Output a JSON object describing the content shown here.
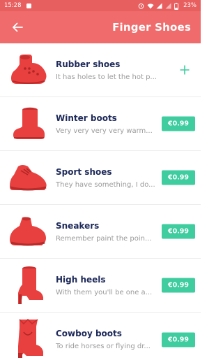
{
  "status_bar": {
    "time": "15:28",
    "battery": "23%"
  },
  "app_bar": {
    "title": "Finger Shoes"
  },
  "items": [
    {
      "name": "Rubber shoes",
      "desc": "It has holes to let the hot p...",
      "action": "add"
    },
    {
      "name": "Winter boots",
      "desc": "Very very very very warm...",
      "action": "price",
      "price": "€0.99"
    },
    {
      "name": "Sport shoes",
      "desc": "They have something, I do...",
      "action": "price",
      "price": "€0.99"
    },
    {
      "name": "Sneakers",
      "desc": "Remember paint the poin...",
      "action": "price",
      "price": "€0.99"
    },
    {
      "name": "High heels",
      "desc": "With them you'll be one a...",
      "action": "price",
      "price": "€0.99"
    },
    {
      "name": "Cowboy boots",
      "desc": "To ride horses or flying dr...",
      "action": "price",
      "price": "€0.99"
    }
  ],
  "colors": {
    "accent": "#f06b6b",
    "price": "#3fcc9f",
    "shoe": "#e8403f"
  }
}
